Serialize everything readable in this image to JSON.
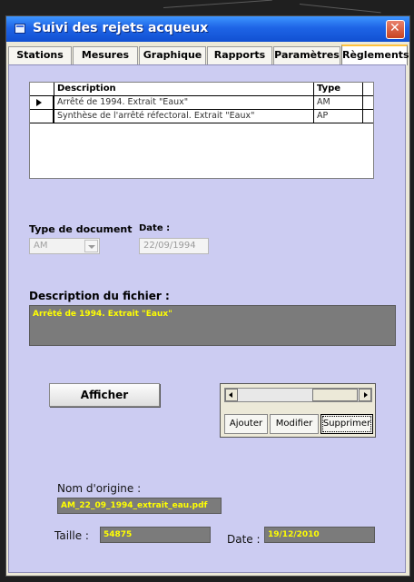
{
  "window": {
    "title": "Suivi des rejets acqueux"
  },
  "tabs": [
    {
      "label": "Stations"
    },
    {
      "label": "Mesures"
    },
    {
      "label": "Graphique"
    },
    {
      "label": "Rapports"
    },
    {
      "label": "Paramètres"
    },
    {
      "label": "Règlements"
    }
  ],
  "active_tab": "Règlements",
  "grid": {
    "headers": {
      "description": "Description",
      "type": "Type"
    },
    "rows": [
      {
        "description": "Arrêté de 1994. Extrait \"Eaux\"",
        "type": "AM",
        "selected": true
      },
      {
        "description": "Synthèse de l'arrêté réfectoral. Extrait \"Eaux\"",
        "type": "AP",
        "selected": false
      }
    ]
  },
  "form": {
    "type_label": "Type de document",
    "type_value": "AM",
    "date_label": "Date :",
    "date_value": "22/09/1994",
    "desc_label": "Description du fichier :",
    "desc_value": "Arrêté de 1994. Extrait \"Eaux\""
  },
  "buttons": {
    "afficher": "Afficher",
    "ajouter": "Ajouter",
    "modifier": "Modifier",
    "supprimer": "Supprimer"
  },
  "file_info": {
    "origin_label": "Nom d'origine :",
    "origin_value": "AM_22_09_1994_extrait_eau.pdf",
    "size_label": "Taille :",
    "size_value": "54875",
    "date_label": "Date :",
    "date_value": "19/12/2010"
  },
  "colors": {
    "panel": "#ccccf2",
    "field_bg": "#7b7b7b",
    "field_text": "#ffff00",
    "title_bar": "#1e64e6"
  }
}
